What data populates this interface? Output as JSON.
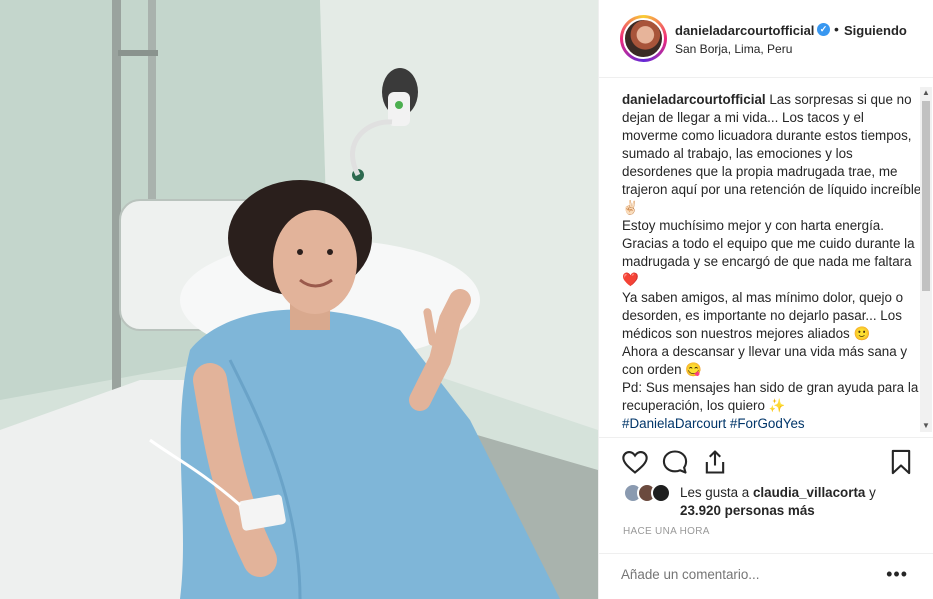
{
  "header": {
    "username": "danieladarcourtofficial",
    "verified_mark": "✓",
    "separator": "•",
    "follow_label": "Siguiendo",
    "location": "San Borja, Lima, Peru"
  },
  "caption": {
    "username": "danieladarcourtofficial",
    "paragraphs": [
      "Las sorpresas si que no dejan de llegar a mi vida... Los tacos y el moverme como licuadora durante estos tiempos, sumado al trabajo, las emociones y los desordenes que la propia madrugada trae, me trajeron aquí por una retención de líquido increíble ✌🏻",
      "Estoy muchísimo mejor y con harta energía. Gracias a todo el equipo que me cuido durante la madrugada y se encargó de que nada me faltara ❤️",
      "Ya saben amigos, al mas mínimo dolor, quejo o desorden, es importante no dejarlo pasar... Los médicos son nuestros mejores aliados 🙂",
      "Ahora a descansar y llevar una vida más sana y con orden 😋",
      "Pd: Sus mensajes han sido de gran ayuda para la recuperación, los quiero ✨"
    ],
    "hashtags": "#DanielaDarcourt #ForGodYes"
  },
  "actions": {
    "like_icon": "heart-icon",
    "comment_icon": "comment-icon",
    "share_icon": "share-icon",
    "save_icon": "bookmark-icon"
  },
  "likes": {
    "prefix": "Les gusta a ",
    "user": "claudia_villacorta",
    "conjunction": " y ",
    "count": "23.920 personas más"
  },
  "timestamp": "HACE UNA HORA",
  "comment_box": {
    "placeholder": "Añade un comentario...",
    "more_label": "•••"
  },
  "colors": {
    "accent": "#3897f0",
    "heart": "#ed4956",
    "gown": "#7fb6d8"
  }
}
